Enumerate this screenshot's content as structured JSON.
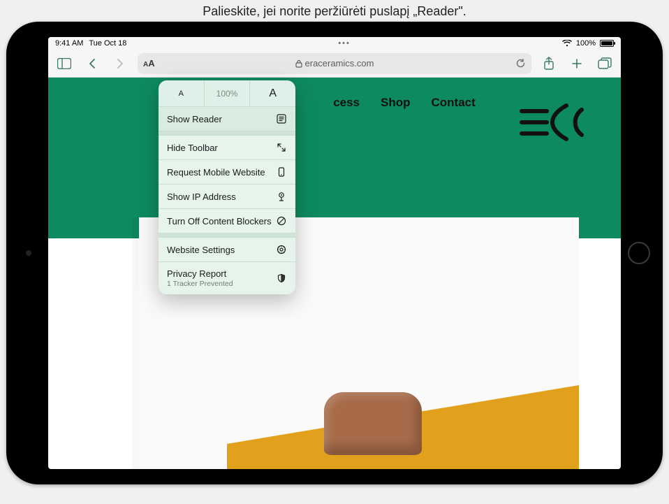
{
  "callout": "Palieskite, jei norite peržiūrėti puslapį „Reader\".",
  "statusbar": {
    "time": "9:41 AM",
    "date": "Tue Oct 18",
    "dots": "•••",
    "wifi_icon": "wifi",
    "battery_pct": "100%"
  },
  "toolbar": {
    "sidebar_icon": "sidebar",
    "back_icon": "chevron-left",
    "forward_icon": "chevron-right",
    "aa_label_small": "A",
    "aa_label": "A",
    "lock_icon": "lock",
    "url": "eraceramics.com",
    "reload_icon": "reload",
    "share_icon": "share",
    "newtab_icon": "plus",
    "tabs_icon": "tabs"
  },
  "popover": {
    "zoom": {
      "decrease": "A",
      "value": "100%",
      "increase": "A"
    },
    "items": [
      {
        "key": "show_reader",
        "label": "Show Reader",
        "icon": "reader"
      },
      {
        "key": "hide_toolbar",
        "label": "Hide Toolbar",
        "icon": "expand"
      },
      {
        "key": "request_mobile",
        "label": "Request Mobile Website",
        "icon": "device"
      },
      {
        "key": "show_ip",
        "label": "Show IP Address",
        "icon": "pin"
      },
      {
        "key": "blockers_off",
        "label": "Turn Off Content Blockers",
        "icon": "nosign"
      },
      {
        "key": "site_settings",
        "label": "Website Settings",
        "icon": "gear"
      },
      {
        "key": "privacy",
        "label": "Privacy Report",
        "sub": "1 Tracker Prevented",
        "icon": "shield"
      }
    ]
  },
  "site": {
    "nav_partial": "cess",
    "shop": "Shop",
    "contact": "Contact",
    "logo": "EC"
  },
  "colors": {
    "accent": "#0e8a5f",
    "popover_bg": "#e6f4ec",
    "toolbar_bg": "#f6f6f7",
    "link": "#3a7a64",
    "orange": "#e2a11c",
    "clay": "#a76b4a"
  }
}
